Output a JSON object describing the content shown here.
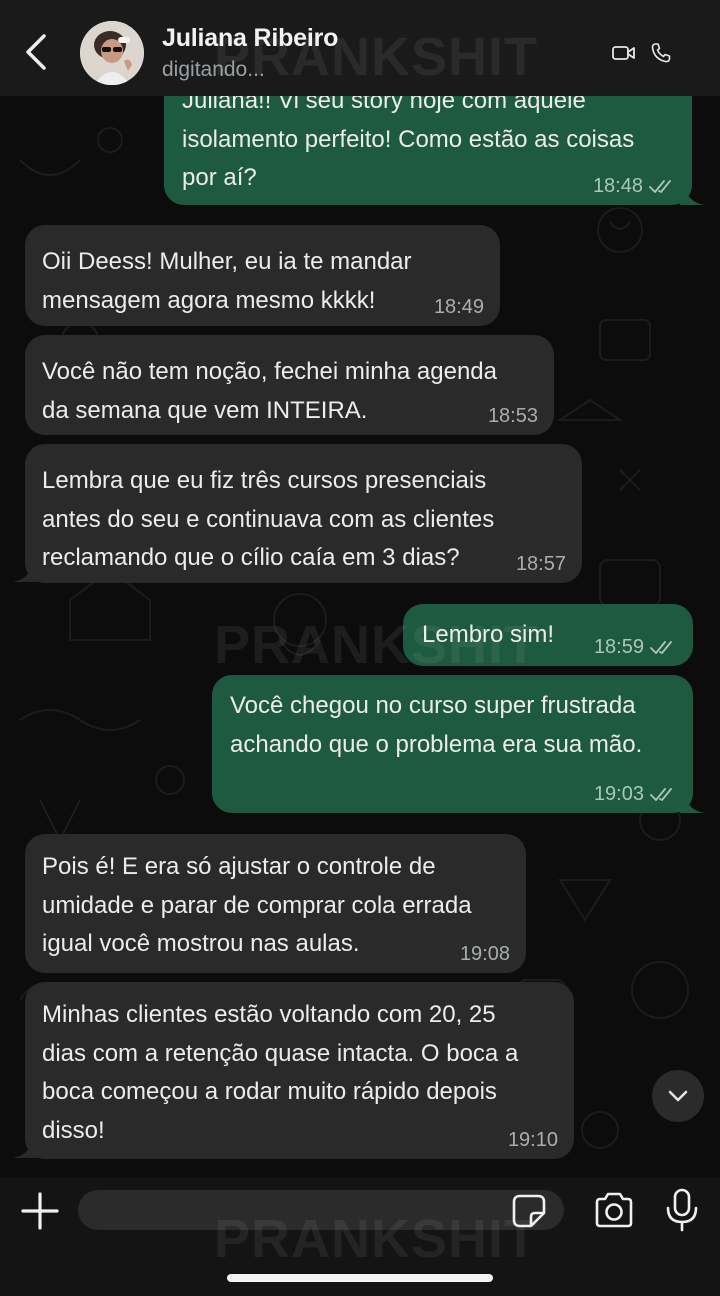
{
  "header": {
    "contact_name": "Juliana Ribeiro",
    "status": "digitando...",
    "icons": [
      "back-arrow-icon",
      "avatar",
      "video-call-icon",
      "phone-icon"
    ]
  },
  "watermark": "PRANKSHIT",
  "messages": [
    {
      "direction": "out",
      "text": "Juliana!! Vi seu story hoje com aquele\nisolamento perfeito! Como estão as coisas\npor aí?",
      "time": "18:48",
      "status": "read"
    },
    {
      "direction": "in",
      "text": "Oii Deess! Mulher, eu ia te mandar\nmensagem agora mesmo kkkk!",
      "time": "18:49"
    },
    {
      "direction": "in",
      "text": "Você não tem noção, fechei minha agenda\nda semana que vem INTEIRA.",
      "time": "18:53"
    },
    {
      "direction": "in",
      "text": "Lembra que eu fiz três cursos presenciais\nantes do seu e continuava com as clientes\nreclamando que o cílio caía em 3 dias?",
      "time": "18:57"
    },
    {
      "direction": "out",
      "text": "Lembro sim!",
      "time": "18:59",
      "status": "read"
    },
    {
      "direction": "out",
      "text": "Você chegou no curso super frustrada\nachando que o problema era sua mão.",
      "time": "19:03",
      "status": "read"
    },
    {
      "direction": "in",
      "text": "Pois é! E era só ajustar o controle de\numidade e parar de comprar cola errada\nigual você mostrou nas aulas.",
      "time": "19:08"
    },
    {
      "direction": "in",
      "text": "Minhas clientes estão voltando com 20, 25\ndias com a retenção quase intacta. O boca a\nboca começou a rodar muito rápido depois\ndisso!",
      "time": "19:10"
    }
  ],
  "composer": {
    "placeholder": "",
    "icons": [
      "plus-icon",
      "sticker-icon",
      "camera-icon",
      "microphone-icon"
    ]
  },
  "colors": {
    "incoming_bubble": "#2a2a2a",
    "outgoing_bubble": "#1d5a3f",
    "header_bg": "#1a1a1a",
    "chat_bg": "#0c0c0c"
  }
}
